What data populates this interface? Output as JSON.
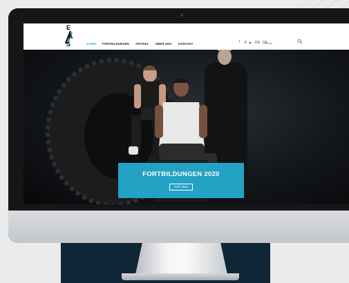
{
  "nav": {
    "logo_letters": [
      "E",
      "A",
      "S"
    ],
    "items": [
      {
        "label": "START",
        "active": true
      },
      {
        "label": "FORTBILDUNGEN",
        "active": false
      },
      {
        "label": "ARTIKEL",
        "active": false
      },
      {
        "label": "ÜBER UNS",
        "active": false
      },
      {
        "label": "KONTAKT",
        "active": false
      }
    ],
    "social": {
      "facebook": "f",
      "instagram": "◎",
      "youtube": "▶"
    },
    "languages": [
      "EN",
      "DE"
    ],
    "search_placeholder": "Suche"
  },
  "hero": {
    "banner_title": "FORTBILDUNGEN 2020",
    "banner_button": "mehr dazu"
  },
  "colors": {
    "accent": "#2aa3c9",
    "banner": "#23a2c4",
    "stand": "#0f2637"
  }
}
